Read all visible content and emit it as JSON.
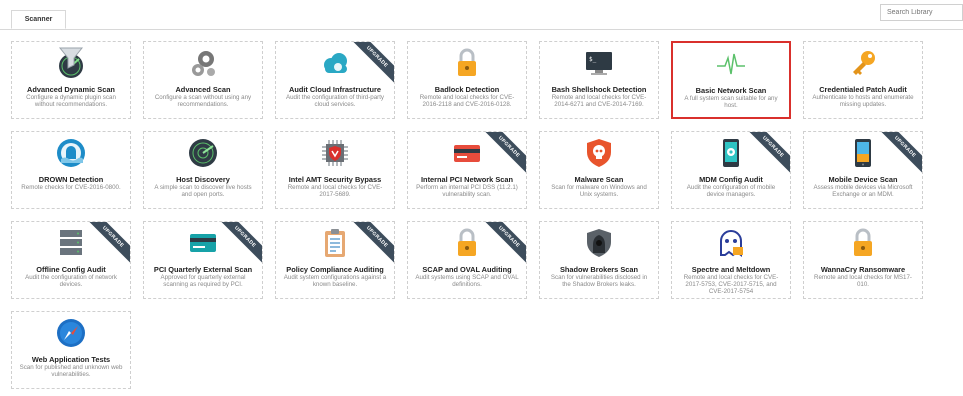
{
  "tabs": {
    "active_label": "Scanner"
  },
  "search": {
    "placeholder": "Search Library"
  },
  "templates": [
    {
      "title": "Advanced Dynamic Scan",
      "desc": "Configure a dynamic plugin scan without recommendations.",
      "icon": "radar-funnel-icon",
      "badge": ""
    },
    {
      "title": "Advanced Scan",
      "desc": "Configure a scan without using any recommendations.",
      "icon": "gears-icon",
      "badge": ""
    },
    {
      "title": "Audit Cloud Infrastructure",
      "desc": "Audit the configuration of third-party cloud services.",
      "icon": "cloud-icon",
      "badge": "UPGRADE"
    },
    {
      "title": "Badlock Detection",
      "desc": "Remote and local checks for CVE-2016-2118 and CVE-2016-0128.",
      "icon": "padlock-icon",
      "badge": ""
    },
    {
      "title": "Bash Shellshock Detection",
      "desc": "Remote and local checks for CVE-2014-6271 and CVE-2014-7169.",
      "icon": "terminal-icon",
      "badge": ""
    },
    {
      "title": "Basic Network Scan",
      "desc": "A full system scan suitable for any host.",
      "icon": "pulse-icon",
      "badge": ""
    },
    {
      "title": "Credentialed Patch Audit",
      "desc": "Authenticate to hosts and enumerate missing updates.",
      "icon": "key-icon",
      "badge": ""
    },
    {
      "title": "DROWN Detection",
      "desc": "Remote checks for CVE-2016-0800.",
      "icon": "drown-icon",
      "badge": ""
    },
    {
      "title": "Host Discovery",
      "desc": "A simple scan to discover live hosts and open ports.",
      "icon": "radar-icon",
      "badge": ""
    },
    {
      "title": "Intel AMT Security Bypass",
      "desc": "Remote and local checks for CVE-2017-5689.",
      "icon": "chip-shield-icon",
      "badge": ""
    },
    {
      "title": "Internal PCI Network Scan",
      "desc": "Perform an internal PCI DSS (11.2.1) vulnerability scan.",
      "icon": "credit-card-icon",
      "badge": "UPGRADE"
    },
    {
      "title": "Malware Scan",
      "desc": "Scan for malware on Windows and Unix systems.",
      "icon": "skull-shield-icon",
      "badge": ""
    },
    {
      "title": "MDM Config Audit",
      "desc": "Audit the configuration of mobile device managers.",
      "icon": "mobile-gear-icon",
      "badge": "UPGRADE"
    },
    {
      "title": "Mobile Device Scan",
      "desc": "Assess mobile devices via Microsoft Exchange or an MDM.",
      "icon": "mobile-icon",
      "badge": "UPGRADE"
    },
    {
      "title": "Offline Config Audit",
      "desc": "Audit the configuration of network devices.",
      "icon": "server-icon",
      "badge": "UPGRADE"
    },
    {
      "title": "PCI Quarterly External Scan",
      "desc": "Approved for quarterly external scanning as required by PCI.",
      "icon": "card-icon",
      "badge": "UPGRADE"
    },
    {
      "title": "Policy Compliance Auditing",
      "desc": "Audit system configurations against a known baseline.",
      "icon": "clipboard-icon",
      "badge": "UPGRADE"
    },
    {
      "title": "SCAP and OVAL Auditing",
      "desc": "Audit systems using SCAP and OVAL definitions.",
      "icon": "padlock-icon",
      "badge": "UPGRADE"
    },
    {
      "title": "Shadow Brokers Scan",
      "desc": "Scan for vulnerabilities disclosed in the Shadow Brokers leaks.",
      "icon": "hooded-figure-icon",
      "badge": ""
    },
    {
      "title": "Spectre and Meltdown",
      "desc": "Remote and local checks for CVE-2017-5753, CVE-2017-5715, and CVE-2017-5754",
      "icon": "ghost-icon",
      "badge": ""
    },
    {
      "title": "WannaCry Ransomware",
      "desc": "Remote and local checks for MS17-010.",
      "icon": "padlock-icon",
      "badge": ""
    },
    {
      "title": "Web Application Tests",
      "desc": "Scan for published and unknown web vulnerabilities.",
      "icon": "compass-icon",
      "badge": ""
    }
  ],
  "selected_template": "Basic Network Scan",
  "colors": {
    "selected_border": "#d9302c",
    "badge": "#3d4d5c",
    "accent": "#4a90c8"
  }
}
